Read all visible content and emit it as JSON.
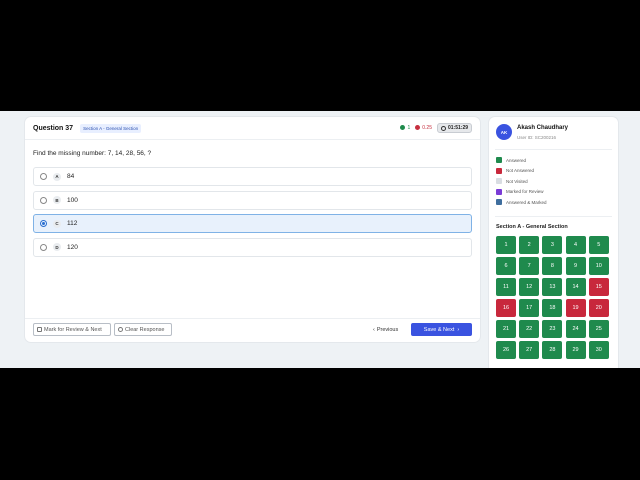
{
  "question": {
    "title": "Question 37",
    "section_badge": "Section A - General Section",
    "marks_positive": "1",
    "marks_negative": "0.25",
    "timer": "01:51:29",
    "text": "Find the missing number: 7, 14, 28, 56, ?",
    "options": [
      {
        "letter": "A",
        "value": "84",
        "selected": false
      },
      {
        "letter": "B",
        "value": "100",
        "selected": false
      },
      {
        "letter": "C",
        "value": "112",
        "selected": true
      },
      {
        "letter": "D",
        "value": "120",
        "selected": false
      }
    ],
    "mark_review_label": "Mark for Review & Next",
    "clear_label": "Clear Response",
    "previous_label": "Previous",
    "save_next_label": "Save & Next"
  },
  "user": {
    "initials": "AK",
    "name": "Akash Chaudhary",
    "user_id": "User ID: SC200216"
  },
  "legend": [
    {
      "label": "Answered",
      "color": "#1f8a4d"
    },
    {
      "label": "Not Answered",
      "color": "#c8283c"
    },
    {
      "label": "Not Visited",
      "color": "#d9dde2"
    },
    {
      "label": "Marked for Review",
      "color": "#7a3bd6"
    },
    {
      "label": "Answered & Marked",
      "color": "#3f6e9e"
    }
  ],
  "section_title": "Section A - General Section",
  "palette": [
    {
      "n": "1",
      "status": "answered"
    },
    {
      "n": "2",
      "status": "answered"
    },
    {
      "n": "3",
      "status": "answered"
    },
    {
      "n": "4",
      "status": "answered"
    },
    {
      "n": "5",
      "status": "answered"
    },
    {
      "n": "6",
      "status": "answered"
    },
    {
      "n": "7",
      "status": "answered"
    },
    {
      "n": "8",
      "status": "answered"
    },
    {
      "n": "9",
      "status": "answered"
    },
    {
      "n": "10",
      "status": "answered"
    },
    {
      "n": "11",
      "status": "answered"
    },
    {
      "n": "12",
      "status": "answered"
    },
    {
      "n": "13",
      "status": "answered"
    },
    {
      "n": "14",
      "status": "answered"
    },
    {
      "n": "15",
      "status": "not_answered"
    },
    {
      "n": "16",
      "status": "not_answered"
    },
    {
      "n": "17",
      "status": "answered"
    },
    {
      "n": "18",
      "status": "answered"
    },
    {
      "n": "19",
      "status": "not_answered"
    },
    {
      "n": "20",
      "status": "not_answered"
    },
    {
      "n": "21",
      "status": "answered"
    },
    {
      "n": "22",
      "status": "answered"
    },
    {
      "n": "23",
      "status": "answered"
    },
    {
      "n": "24",
      "status": "answered"
    },
    {
      "n": "25",
      "status": "answered"
    },
    {
      "n": "26",
      "status": "answered"
    },
    {
      "n": "27",
      "status": "answered"
    },
    {
      "n": "28",
      "status": "answered"
    },
    {
      "n": "29",
      "status": "answered"
    },
    {
      "n": "30",
      "status": "answered"
    }
  ],
  "colors": {
    "answered": "#1f8a4d",
    "not_answered": "#c8283c",
    "accent": "#3a53e0"
  }
}
